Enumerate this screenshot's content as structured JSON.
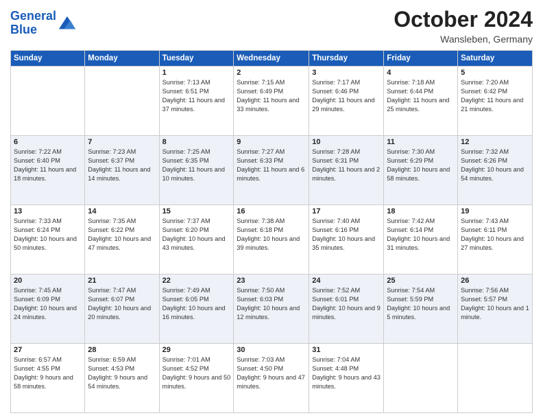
{
  "header": {
    "logo_line1": "General",
    "logo_line2": "Blue",
    "month": "October 2024",
    "location": "Wansleben, Germany"
  },
  "days_of_week": [
    "Sunday",
    "Monday",
    "Tuesday",
    "Wednesday",
    "Thursday",
    "Friday",
    "Saturday"
  ],
  "weeks": [
    [
      {
        "day": "",
        "content": ""
      },
      {
        "day": "",
        "content": ""
      },
      {
        "day": "1",
        "content": "Sunrise: 7:13 AM\nSunset: 6:51 PM\nDaylight: 11 hours and 37 minutes."
      },
      {
        "day": "2",
        "content": "Sunrise: 7:15 AM\nSunset: 6:49 PM\nDaylight: 11 hours and 33 minutes."
      },
      {
        "day": "3",
        "content": "Sunrise: 7:17 AM\nSunset: 6:46 PM\nDaylight: 11 hours and 29 minutes."
      },
      {
        "day": "4",
        "content": "Sunrise: 7:18 AM\nSunset: 6:44 PM\nDaylight: 11 hours and 25 minutes."
      },
      {
        "day": "5",
        "content": "Sunrise: 7:20 AM\nSunset: 6:42 PM\nDaylight: 11 hours and 21 minutes."
      }
    ],
    [
      {
        "day": "6",
        "content": "Sunrise: 7:22 AM\nSunset: 6:40 PM\nDaylight: 11 hours and 18 minutes."
      },
      {
        "day": "7",
        "content": "Sunrise: 7:23 AM\nSunset: 6:37 PM\nDaylight: 11 hours and 14 minutes."
      },
      {
        "day": "8",
        "content": "Sunrise: 7:25 AM\nSunset: 6:35 PM\nDaylight: 11 hours and 10 minutes."
      },
      {
        "day": "9",
        "content": "Sunrise: 7:27 AM\nSunset: 6:33 PM\nDaylight: 11 hours and 6 minutes."
      },
      {
        "day": "10",
        "content": "Sunrise: 7:28 AM\nSunset: 6:31 PM\nDaylight: 11 hours and 2 minutes."
      },
      {
        "day": "11",
        "content": "Sunrise: 7:30 AM\nSunset: 6:29 PM\nDaylight: 10 hours and 58 minutes."
      },
      {
        "day": "12",
        "content": "Sunrise: 7:32 AM\nSunset: 6:26 PM\nDaylight: 10 hours and 54 minutes."
      }
    ],
    [
      {
        "day": "13",
        "content": "Sunrise: 7:33 AM\nSunset: 6:24 PM\nDaylight: 10 hours and 50 minutes."
      },
      {
        "day": "14",
        "content": "Sunrise: 7:35 AM\nSunset: 6:22 PM\nDaylight: 10 hours and 47 minutes."
      },
      {
        "day": "15",
        "content": "Sunrise: 7:37 AM\nSunset: 6:20 PM\nDaylight: 10 hours and 43 minutes."
      },
      {
        "day": "16",
        "content": "Sunrise: 7:38 AM\nSunset: 6:18 PM\nDaylight: 10 hours and 39 minutes."
      },
      {
        "day": "17",
        "content": "Sunrise: 7:40 AM\nSunset: 6:16 PM\nDaylight: 10 hours and 35 minutes."
      },
      {
        "day": "18",
        "content": "Sunrise: 7:42 AM\nSunset: 6:14 PM\nDaylight: 10 hours and 31 minutes."
      },
      {
        "day": "19",
        "content": "Sunrise: 7:43 AM\nSunset: 6:11 PM\nDaylight: 10 hours and 27 minutes."
      }
    ],
    [
      {
        "day": "20",
        "content": "Sunrise: 7:45 AM\nSunset: 6:09 PM\nDaylight: 10 hours and 24 minutes."
      },
      {
        "day": "21",
        "content": "Sunrise: 7:47 AM\nSunset: 6:07 PM\nDaylight: 10 hours and 20 minutes."
      },
      {
        "day": "22",
        "content": "Sunrise: 7:49 AM\nSunset: 6:05 PM\nDaylight: 10 hours and 16 minutes."
      },
      {
        "day": "23",
        "content": "Sunrise: 7:50 AM\nSunset: 6:03 PM\nDaylight: 10 hours and 12 minutes."
      },
      {
        "day": "24",
        "content": "Sunrise: 7:52 AM\nSunset: 6:01 PM\nDaylight: 10 hours and 9 minutes."
      },
      {
        "day": "25",
        "content": "Sunrise: 7:54 AM\nSunset: 5:59 PM\nDaylight: 10 hours and 5 minutes."
      },
      {
        "day": "26",
        "content": "Sunrise: 7:56 AM\nSunset: 5:57 PM\nDaylight: 10 hours and 1 minute."
      }
    ],
    [
      {
        "day": "27",
        "content": "Sunrise: 6:57 AM\nSunset: 4:55 PM\nDaylight: 9 hours and 58 minutes."
      },
      {
        "day": "28",
        "content": "Sunrise: 6:59 AM\nSunset: 4:53 PM\nDaylight: 9 hours and 54 minutes."
      },
      {
        "day": "29",
        "content": "Sunrise: 7:01 AM\nSunset: 4:52 PM\nDaylight: 9 hours and 50 minutes."
      },
      {
        "day": "30",
        "content": "Sunrise: 7:03 AM\nSunset: 4:50 PM\nDaylight: 9 hours and 47 minutes."
      },
      {
        "day": "31",
        "content": "Sunrise: 7:04 AM\nSunset: 4:48 PM\nDaylight: 9 hours and 43 minutes."
      },
      {
        "day": "",
        "content": ""
      },
      {
        "day": "",
        "content": ""
      }
    ]
  ]
}
